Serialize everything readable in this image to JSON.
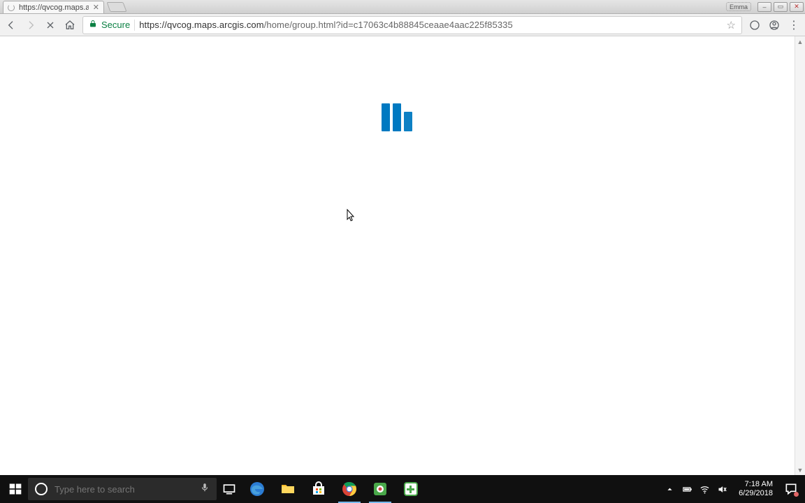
{
  "window": {
    "user_badge": "Emma",
    "min_label": "–",
    "max_label": "▭",
    "close_label": "✕"
  },
  "browser": {
    "tab": {
      "title": "https://qvcog.maps.arcg"
    },
    "secure_label": "Secure",
    "url_host": "https://qvcog.maps.arcgis.com",
    "url_path": "/home/group.html?id=c17063c4b88845ceaae4aac225f85335"
  },
  "taskbar": {
    "search_placeholder": "Type here to search",
    "clock_time": "7:18 AM",
    "clock_date": "6/29/2018"
  }
}
